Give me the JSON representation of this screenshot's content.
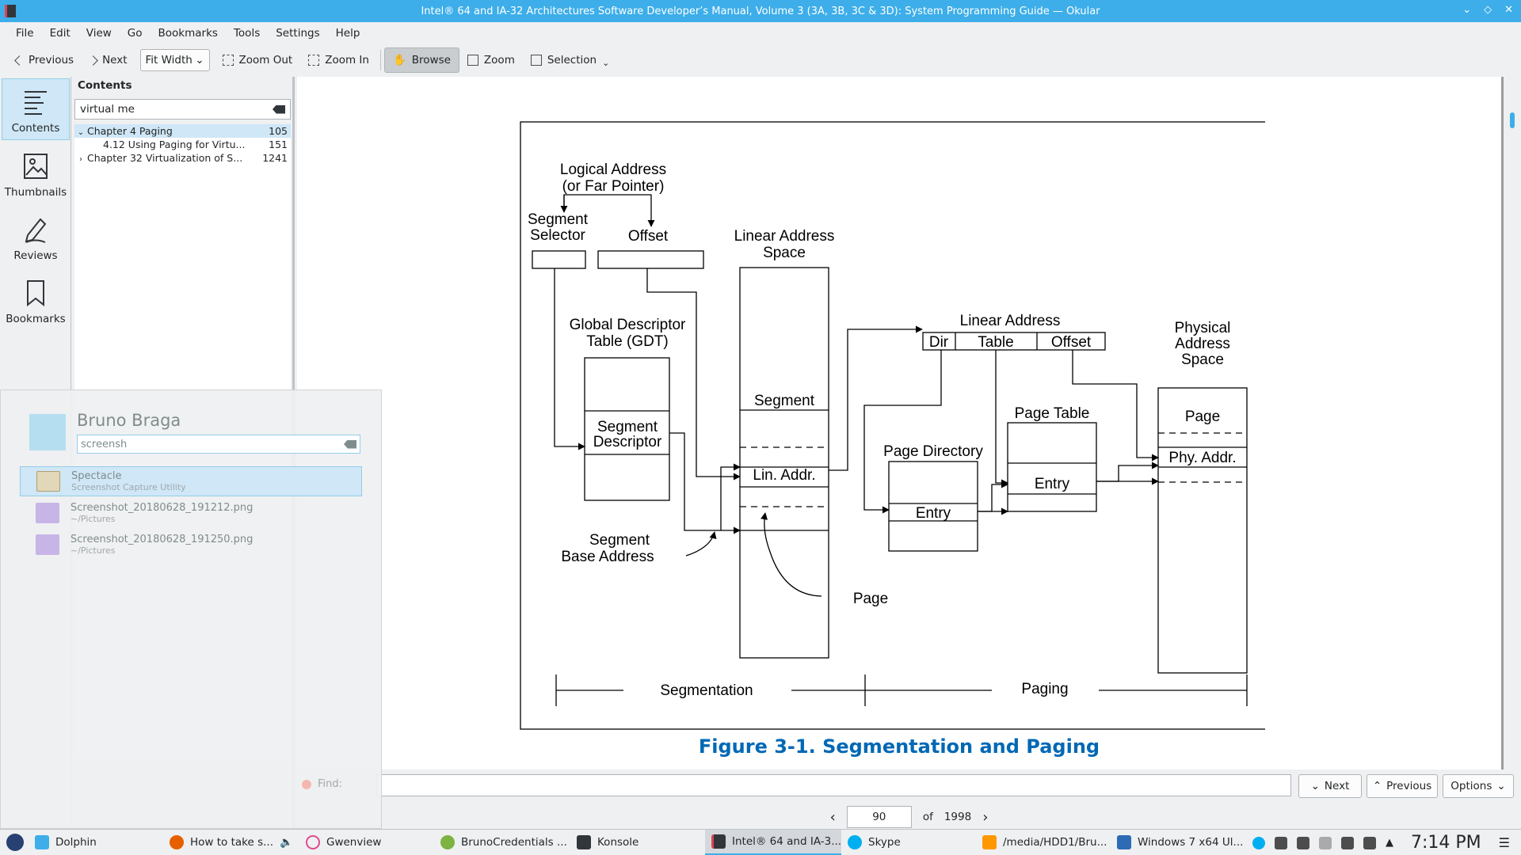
{
  "window": {
    "title": "Intel® 64 and IA-32 Architectures Software Developer’s Manual, Volume 3 (3A, 3B, 3C & 3D): System Programming Guide — Okular"
  },
  "menu": [
    "File",
    "Edit",
    "View",
    "Go",
    "Bookmarks",
    "Tools",
    "Settings",
    "Help"
  ],
  "toolbar": {
    "previous": "Previous",
    "next": "Next",
    "zoom_mode": "Fit Width",
    "zoom_out": "Zoom Out",
    "zoom_in": "Zoom In",
    "browse": "Browse",
    "zoom": "Zoom",
    "selection": "Selection"
  },
  "sidebar": {
    "tabs": [
      "Contents",
      "Thumbnails",
      "Reviews",
      "Bookmarks"
    ]
  },
  "contents": {
    "heading": "Contents",
    "search_value": "virtual me",
    "items": [
      {
        "label": "Chapter 4 Paging",
        "page": "105"
      },
      {
        "label": "4.12 Using Paging for Virtu...",
        "page": "151"
      },
      {
        "label": "Chapter 32 Virtualization of S...",
        "page": "1241"
      }
    ]
  },
  "figure": {
    "caption": "Figure 3-1.  Segmentation and Paging",
    "labels": {
      "logical_address": "Logical Address",
      "far_pointer": "(or Far Pointer)",
      "segment": "Segment",
      "selector": "Selector",
      "offset": "Offset",
      "linear_address": "Linear Address",
      "space": "Space",
      "gdt_1": "Global Descriptor",
      "gdt_2": "Table (GDT)",
      "segment_descriptor_1": "Segment",
      "segment_descriptor_2": "Descriptor",
      "lin_addr": "Lin. Addr.",
      "segment_base_1": "Segment",
      "segment_base_2": "Base Address",
      "page": "Page",
      "linear_address_title": "Linear Address",
      "dir": "Dir",
      "table": "Table",
      "offset2": "Offset",
      "page_directory": "Page Directory",
      "entry": "Entry",
      "page_table": "Page Table",
      "physical_1": "Physical",
      "physical_2": "Address",
      "physical_3": "Space",
      "phys_page": "Page",
      "phy_addr": "Phy. Addr.",
      "segmentation": "Segmentation",
      "paging": "Paging"
    }
  },
  "findbar": {
    "next": "Next",
    "previous": "Previous",
    "options": "Options"
  },
  "pagenav": {
    "current": "90",
    "of": "of",
    "total": "1998"
  },
  "launcher": {
    "user": "Bruno Braga",
    "search_value": "screensh",
    "results": [
      {
        "title": "Spectacle",
        "subtitle": "Screenshot Capture Utility"
      },
      {
        "title": "Screenshot_20180628_191212.png",
        "subtitle": "~/Pictures"
      },
      {
        "title": "Screenshot_20180628_191250.png",
        "subtitle": "~/Pictures"
      }
    ],
    "find_label": "Find:"
  },
  "taskbar": {
    "tasks": [
      {
        "label": "Dolphin",
        "color": "#3daee9"
      },
      {
        "label": "How to take s...",
        "color": "#e66000"
      },
      {
        "label": "Gwenview",
        "color": "#e04a8f"
      },
      {
        "label": "BrunoCredentials ...",
        "color": "#7cb342"
      },
      {
        "label": "Konsole",
        "color": "#31363b"
      },
      {
        "label": "Intel® 64 and IA-3...",
        "color": "#da4453"
      },
      {
        "label": "Skype",
        "color": "#00aff0"
      },
      {
        "label": "/media/HDD1/Bru...",
        "color": "#ff9800"
      },
      {
        "label": "Windows 7 x64 Ul...",
        "color": "#2d6bb5"
      }
    ],
    "clock": "7:14 PM"
  },
  "colors": {
    "accent": "#3daee9",
    "caption": "#0068b5"
  }
}
